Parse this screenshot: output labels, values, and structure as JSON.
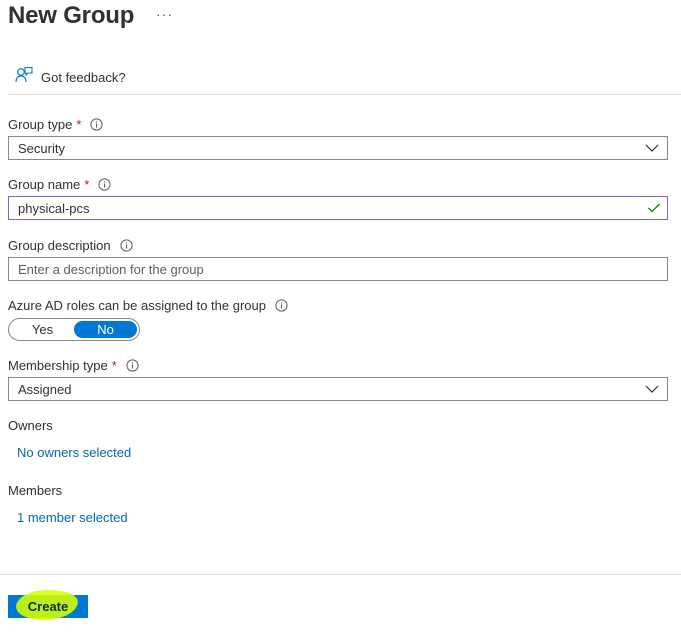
{
  "header": {
    "title": "New Group",
    "more_label": "···"
  },
  "feedback": {
    "label": "Got feedback?"
  },
  "form": {
    "group_type": {
      "label": "Group type",
      "required": "*",
      "value": "Security"
    },
    "group_name": {
      "label": "Group name",
      "required": "*",
      "value": "physical-pcs"
    },
    "group_description": {
      "label": "Group description",
      "placeholder": "Enter a description for the group"
    },
    "azure_ad_roles": {
      "label": "Azure AD roles can be assigned to the group",
      "yes_label": "Yes",
      "no_label": "No",
      "selected": "No"
    },
    "membership_type": {
      "label": "Membership type",
      "required": "*",
      "value": "Assigned"
    },
    "owners": {
      "label": "Owners",
      "link": "No owners selected"
    },
    "members": {
      "label": "Members",
      "link": "1 member selected"
    }
  },
  "footer": {
    "create_label": "Create"
  },
  "colors": {
    "accent": "#0078d4",
    "link": "#0067b8",
    "required": "#a4262c",
    "valid_border": "#8764b8",
    "valid_check": "#107c10",
    "highlight": "#d6ff00"
  }
}
